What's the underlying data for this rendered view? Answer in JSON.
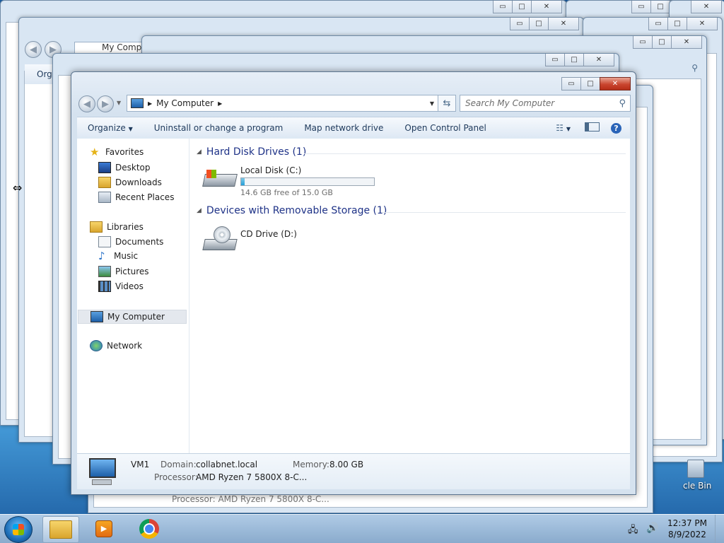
{
  "desktop": {
    "recycle_bin_label": "cle Bin"
  },
  "background_windows": {
    "address_text": "My Comp",
    "organize_label": "Orga",
    "processor_text": "Processor: AMD Ryzen 7 5800X 8-C..."
  },
  "window": {
    "controls": {
      "minimize": "▭",
      "maximize": "□",
      "close": "✕"
    },
    "address": {
      "text": "My Computer"
    },
    "search": {
      "placeholder": "Search My Computer"
    },
    "toolbar": {
      "organize": "Organize",
      "uninstall": "Uninstall or change a program",
      "map_network": "Map network drive",
      "control_panel": "Open Control Panel"
    },
    "nav": {
      "favorites": "Favorites",
      "desktop": "Desktop",
      "downloads": "Downloads",
      "recent_places": "Recent Places",
      "libraries": "Libraries",
      "documents": "Documents",
      "music": "Music",
      "pictures": "Pictures",
      "videos": "Videos",
      "my_computer": "My Computer",
      "network": "Network"
    },
    "groups": {
      "hdd": "Hard Disk Drives (1)",
      "removable": "Devices with Removable Storage (1)"
    },
    "drives": {
      "c_name": "Local Disk (C:)",
      "c_free": "14.6 GB free of 15.0 GB",
      "c_used_fraction": 0.027,
      "d_name": "CD Drive (D:)"
    },
    "details": {
      "name": "VM1",
      "domain_label": "Domain:",
      "domain_value": "collabnet.local",
      "memory_label": "Memory:",
      "memory_value": "8.00 GB",
      "processor_label": "Processor:",
      "processor_value": "AMD Ryzen 7 5800X 8-C..."
    }
  },
  "taskbar": {
    "time": "12:37 PM",
    "date": "8/9/2022"
  }
}
